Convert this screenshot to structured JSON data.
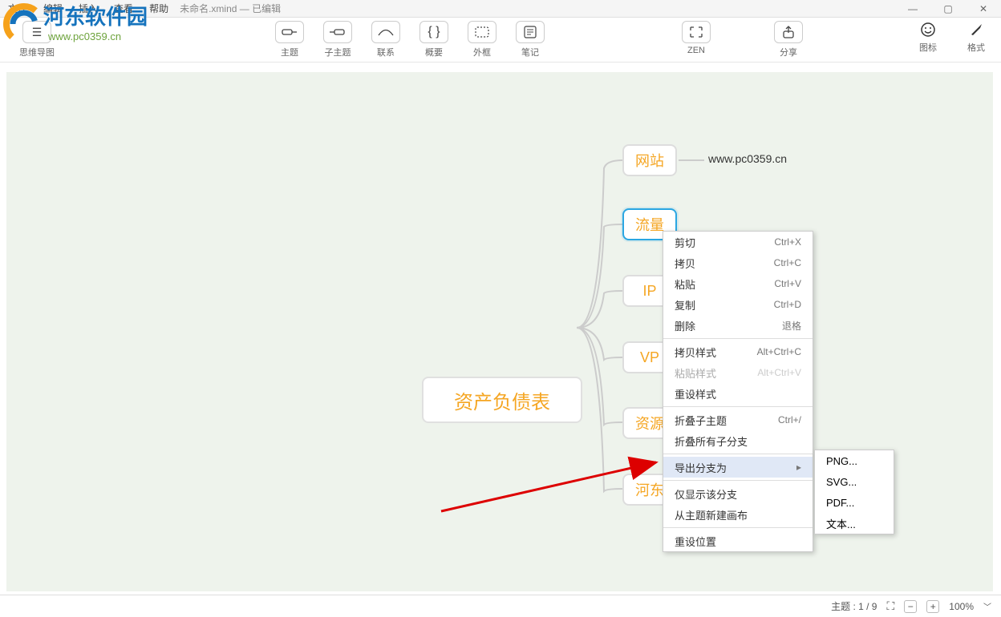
{
  "menu": {
    "items": [
      "文件",
      "编辑",
      "插入",
      "查看",
      "帮助"
    ],
    "title": "未命名.xmind — 已编辑"
  },
  "toolbar_left": {
    "label0": "思维导图"
  },
  "toolbar_center": [
    {
      "label": "主题"
    },
    {
      "label": "子主题"
    },
    {
      "label": "联系"
    },
    {
      "label": "概要"
    },
    {
      "label": "外框"
    },
    {
      "label": "笔记"
    }
  ],
  "toolbar_r": {
    "zen": "ZEN",
    "share": "分享"
  },
  "toolbar_right": [
    {
      "label": "图标"
    },
    {
      "label": "格式"
    }
  ],
  "mindmap": {
    "center": "资产负债表",
    "children": [
      {
        "label": "网站",
        "leaf": "www.pc0359.cn"
      },
      {
        "label": "流量"
      },
      {
        "label": "IP"
      },
      {
        "label": "VP"
      },
      {
        "label": "资源"
      },
      {
        "label": "河东"
      }
    ]
  },
  "context_menu": {
    "items": [
      {
        "label": "剪切",
        "shortcut": "Ctrl+X"
      },
      {
        "label": "拷贝",
        "shortcut": "Ctrl+C"
      },
      {
        "label": "粘贴",
        "shortcut": "Ctrl+V"
      },
      {
        "label": "复制",
        "shortcut": "Ctrl+D"
      },
      {
        "label": "删除",
        "shortcut": "退格"
      },
      {
        "sep": true
      },
      {
        "label": "拷贝样式",
        "shortcut": "Alt+Ctrl+C"
      },
      {
        "label": "粘贴样式",
        "shortcut": "Alt+Ctrl+V",
        "disabled": true
      },
      {
        "label": "重设样式"
      },
      {
        "sep": true
      },
      {
        "label": "折叠子主题",
        "shortcut": "Ctrl+/"
      },
      {
        "label": "折叠所有子分支"
      },
      {
        "sep": true
      },
      {
        "label": "导出分支为",
        "submenu": true,
        "highlight": true
      },
      {
        "sep": true
      },
      {
        "label": "仅显示该分支"
      },
      {
        "label": "从主题新建画布"
      },
      {
        "sep": true
      },
      {
        "label": "重设位置"
      }
    ],
    "submenu_items": [
      "PNG...",
      "SVG...",
      "PDF...",
      "文本..."
    ]
  },
  "status": {
    "topic": "主题 : 1 / 9",
    "zoom": "100%"
  },
  "watermark": {
    "brand": "河东软件园",
    "url": "www.pc0359.cn"
  }
}
